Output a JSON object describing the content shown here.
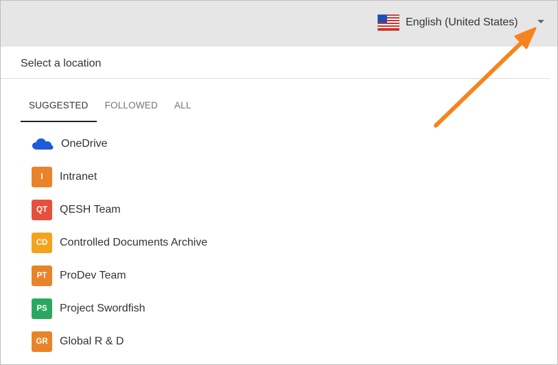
{
  "header": {
    "language": {
      "label": "English (United States)",
      "flag_icon": "us-flag-icon"
    },
    "dropdown_icon": "caret-down-icon"
  },
  "location_picker": {
    "heading": "Select a location",
    "tabs": [
      {
        "label": "SUGGESTED",
        "active": true
      },
      {
        "label": "FOLLOWED",
        "active": false
      },
      {
        "label": "ALL",
        "active": false
      }
    ],
    "items": [
      {
        "label": "OneDrive",
        "icon": "onedrive-cloud-icon",
        "color": "#1e5bd8"
      },
      {
        "label": "Intranet",
        "initials": "I",
        "color": "#e9832a"
      },
      {
        "label": "QESH Team",
        "initials": "QT",
        "color": "#e5503c"
      },
      {
        "label": "Controlled Documents Archive",
        "initials": "CD",
        "color": "#f5a21c"
      },
      {
        "label": "ProDev Team",
        "initials": "PT",
        "color": "#e9832a"
      },
      {
        "label": "Project Swordfish",
        "initials": "PS",
        "color": "#2ba85f"
      },
      {
        "label": "Global R & D",
        "initials": "GR",
        "color": "#e9832a"
      }
    ]
  },
  "annotation": {
    "arrow_color": "#f5841f"
  }
}
